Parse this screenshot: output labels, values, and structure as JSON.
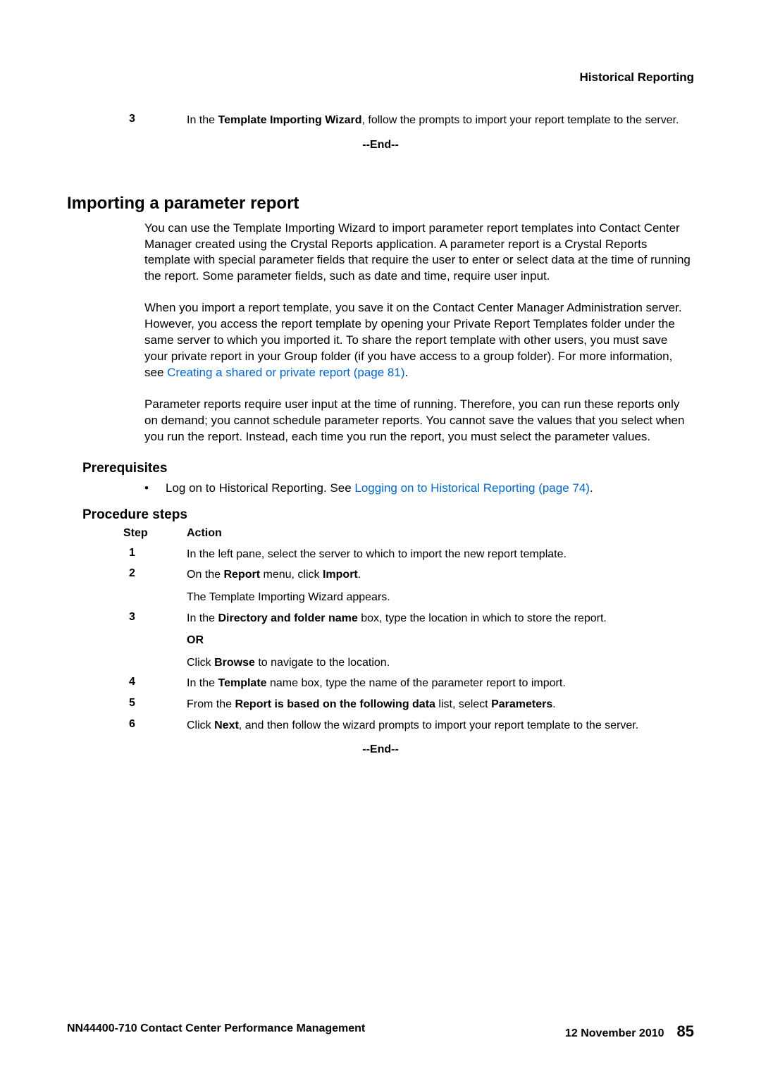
{
  "header": {
    "section": "Historical Reporting"
  },
  "top_step": {
    "num": "3",
    "text_a": "In the ",
    "text_b": "Template Importing Wizard",
    "text_c": ", follow the prompts to import your report template to the server."
  },
  "end_marker": "--End--",
  "heading": "Importing a parameter report",
  "para1": "You can use the Template Importing Wizard to import parameter report templates into Contact Center Manager created using the Crystal Reports application. A parameter report is a Crystal Reports template with special parameter fields that require the user to enter or select data at the time of running the report. Some parameter fields, such as date and time, require user input.",
  "para2a": "When you import a report template, you save it on the Contact Center Manager Administration server. However, you access the report template by opening your Private Report Templates folder under the same server to which you imported it. To share the report template with other users, you must save your private report in your Group folder (if you have access to a group folder). For more information, see ",
  "para2link": "Creating a shared or private report (page 81)",
  "para2b": ".",
  "para3": "Parameter reports require user input at the time of running. Therefore, you can run these reports only on demand; you cannot schedule parameter reports. You cannot save the values that you select when you run the report. Instead, each time you run the report, you must select the parameter values.",
  "prereq_heading": "Prerequisites",
  "prereq_bullet_dot": "•",
  "prereq_bullet_a": "Log on to Historical Reporting. See ",
  "prereq_bullet_link": "Logging on to Historical Reporting (page 74)",
  "prereq_bullet_b": ".",
  "proc_heading": "Procedure steps",
  "proc_cols": {
    "step": "Step",
    "action": "Action"
  },
  "steps": {
    "s1": {
      "num": "1",
      "text": "In the left pane, select the server to which to import the new report template."
    },
    "s2": {
      "num": "2",
      "a": "On the ",
      "b": "Report",
      "c": " menu, click ",
      "d": "Import",
      "e": ".",
      "sub": "The Template Importing Wizard appears."
    },
    "s3": {
      "num": "3",
      "a": "In the ",
      "b": "Directory and folder name",
      "c": " box, type the location in which to store the report.",
      "or": "OR",
      "sub_a": "Click ",
      "sub_b": "Browse",
      "sub_c": " to navigate to the location."
    },
    "s4": {
      "num": "4",
      "a": "In the ",
      "b": "Template",
      "c": " name box, type the name of the parameter report to import."
    },
    "s5": {
      "num": "5",
      "a": "From the ",
      "b": "Report is based on the following data",
      "c": " list, select ",
      "d": "Parameters",
      "e": "."
    },
    "s6": {
      "num": "6",
      "a": "Click ",
      "b": "Next",
      "c": ", and then follow the wizard prompts to import your report template to the server."
    }
  },
  "footer": {
    "left": "NN44400-710 Contact Center Performance Management",
    "date": "12 November 2010",
    "page": "85"
  }
}
